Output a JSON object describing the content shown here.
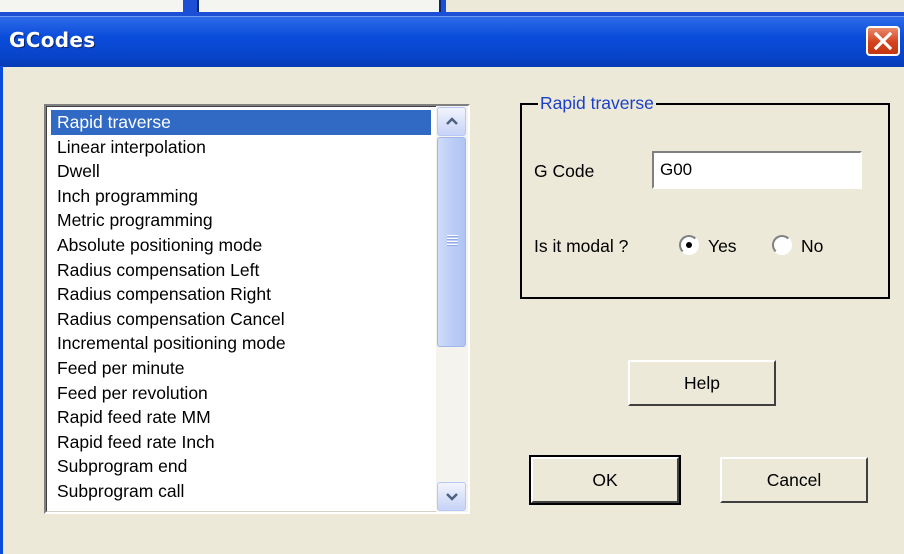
{
  "dialog": {
    "title": "GCodes"
  },
  "list": {
    "items": [
      "Rapid traverse",
      "Linear interpolation",
      "Dwell",
      "Inch programming",
      "Metric programming",
      "Absolute positioning mode",
      "Radius compensation Left",
      "Radius compensation Right",
      "Radius compensation Cancel",
      "Incremental positioning mode",
      "Feed per minute",
      "Feed per revolution",
      "Rapid feed rate MM",
      "Rapid feed rate Inch",
      "Subprogram end",
      "Subprogram call"
    ],
    "selected_index": 0
  },
  "group": {
    "legend": "Rapid traverse",
    "gcode_label": "G Code",
    "gcode_value": "G00",
    "modal_label": "Is it modal ?",
    "yes_label": "Yes",
    "no_label": "No",
    "modal_selected": "Yes"
  },
  "buttons": {
    "help": "Help",
    "ok": "OK",
    "cancel": "Cancel"
  },
  "colors": {
    "selection": "#316ac5",
    "titlebar": "#0a4cdb",
    "legend": "#1a3fc8",
    "close": "#d4421d"
  }
}
